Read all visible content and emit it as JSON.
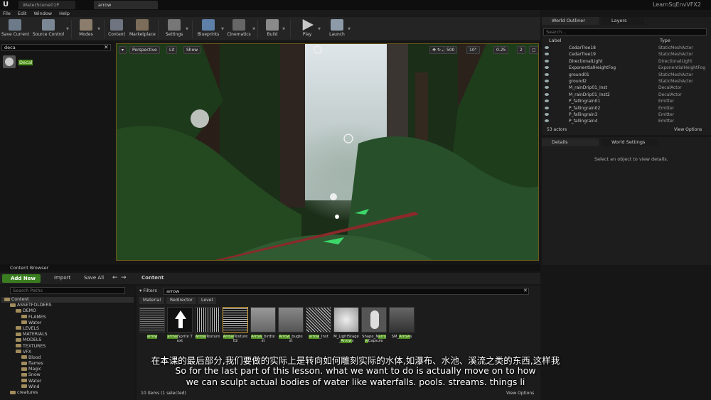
{
  "titlebar": {
    "tabs": [
      "WaterScene01P",
      "arrow"
    ],
    "project": "LearnSqEnvVFX2"
  },
  "menu": [
    "File",
    "Edit",
    "Window",
    "Help"
  ],
  "toolbar": [
    "Save Current",
    "Source Control",
    "Modes",
    "Content",
    "Marketplace",
    "Settings",
    "Blueprints",
    "Cinematics",
    "Build",
    "Play",
    "Launch"
  ],
  "modes": {
    "search_value": "deca",
    "result": "Decal"
  },
  "viewport": {
    "perspective": "Perspective",
    "lit": "Lit",
    "show": "Show",
    "grid": "500",
    "angle": "10°",
    "scale": "0.25",
    "cam": "2"
  },
  "outliner": {
    "tabs": [
      "World Outliner",
      "Layers"
    ],
    "search_placeholder": "Search...",
    "col_label": "Label",
    "col_type": "Type",
    "rows": [
      {
        "name": "CedarTree18",
        "type": "StaticMeshActor"
      },
      {
        "name": "CedarTree19",
        "type": "StaticMeshActor"
      },
      {
        "name": "DirectionalLight",
        "type": "DirectionalLight"
      },
      {
        "name": "ExponentialHeightFog",
        "type": "ExponentialHeightFog"
      },
      {
        "name": "ground01",
        "type": "StaticMeshActor"
      },
      {
        "name": "ground2",
        "type": "StaticMeshActor"
      },
      {
        "name": "M_rainDrip01_Inst",
        "type": "DecalActor"
      },
      {
        "name": "M_rainDrip01_Inst2",
        "type": "DecalActor"
      },
      {
        "name": "P_fallingrain01",
        "type": "Emitter"
      },
      {
        "name": "P_fallingrain02",
        "type": "Emitter"
      },
      {
        "name": "P_fallingrain3",
        "type": "Emitter"
      },
      {
        "name": "P_fallingrain4",
        "type": "Emitter"
      }
    ],
    "count": "53 actors",
    "view_options": "View Options"
  },
  "details": {
    "tabs": [
      "Details",
      "World Settings"
    ],
    "empty": "Select an object to view details."
  },
  "content_browser": {
    "title": "Content Browser",
    "add_new": "Add New",
    "import": "Import",
    "save_all": "Save All",
    "path": "Content",
    "search_paths": "Search Paths",
    "filters": "Filters",
    "search_value": "arrow",
    "filter_tabs": [
      "Material",
      "Redirector",
      "Level"
    ],
    "tree": [
      {
        "label": "Content",
        "depth": 0
      },
      {
        "label": "ASSETFOLDERS",
        "depth": 1
      },
      {
        "label": "DEMO",
        "depth": 2
      },
      {
        "label": "FLAMES",
        "depth": 3
      },
      {
        "label": "Water",
        "depth": 3
      },
      {
        "label": "LEVELS",
        "depth": 2
      },
      {
        "label": "MATERIALS",
        "depth": 2
      },
      {
        "label": "MODELS",
        "depth": 2
      },
      {
        "label": "TEXTURES",
        "depth": 2
      },
      {
        "label": "VFX",
        "depth": 2
      },
      {
        "label": "Blood",
        "depth": 3
      },
      {
        "label": "flames",
        "depth": 3
      },
      {
        "label": "Magic",
        "depth": 3
      },
      {
        "label": "Snow",
        "depth": 3
      },
      {
        "label": "Water",
        "depth": 3
      },
      {
        "label": "Wind",
        "depth": 3
      },
      {
        "label": "creatures",
        "depth": 1
      }
    ],
    "assets": [
      {
        "pre": "",
        "hl": "arrow",
        "post": ""
      },
      {
        "pre": "",
        "hl": "arrow",
        "post": "Sprite Text"
      },
      {
        "pre": "",
        "hl": "Arrow",
        "post": "Texture"
      },
      {
        "pre": "",
        "hl": "Arrow",
        "post": "Texture02"
      },
      {
        "pre": "",
        "hl": "Arrow",
        "post": "_birdtest"
      },
      {
        "pre": "",
        "hl": "Arrow",
        "post": "_bugtest"
      },
      {
        "pre": "",
        "hl": "arrow",
        "post": "_Inst"
      },
      {
        "pre": "M_LightStage_",
        "hl": "Arrow",
        "post": "s"
      },
      {
        "pre": "Shape_N",
        "hl": "arrow",
        "post": "Capsule"
      },
      {
        "pre": "SM_",
        "hl": "Arrow",
        "post": "s"
      }
    ],
    "items_status": "10 items (1 selected)",
    "view_options": "View Options"
  },
  "subtitles": {
    "zh": "在本课的最后部分,我们要做的实际上是转向如何雕刻实际的水体,如瀑布、水池、溪流之类的东西,这样我",
    "en1": "So for the last part of this lesson. what we want to do is actually move on to how",
    "en2": "we can sculpt actual bodies of water like waterfalls. pools. streams. things li"
  }
}
